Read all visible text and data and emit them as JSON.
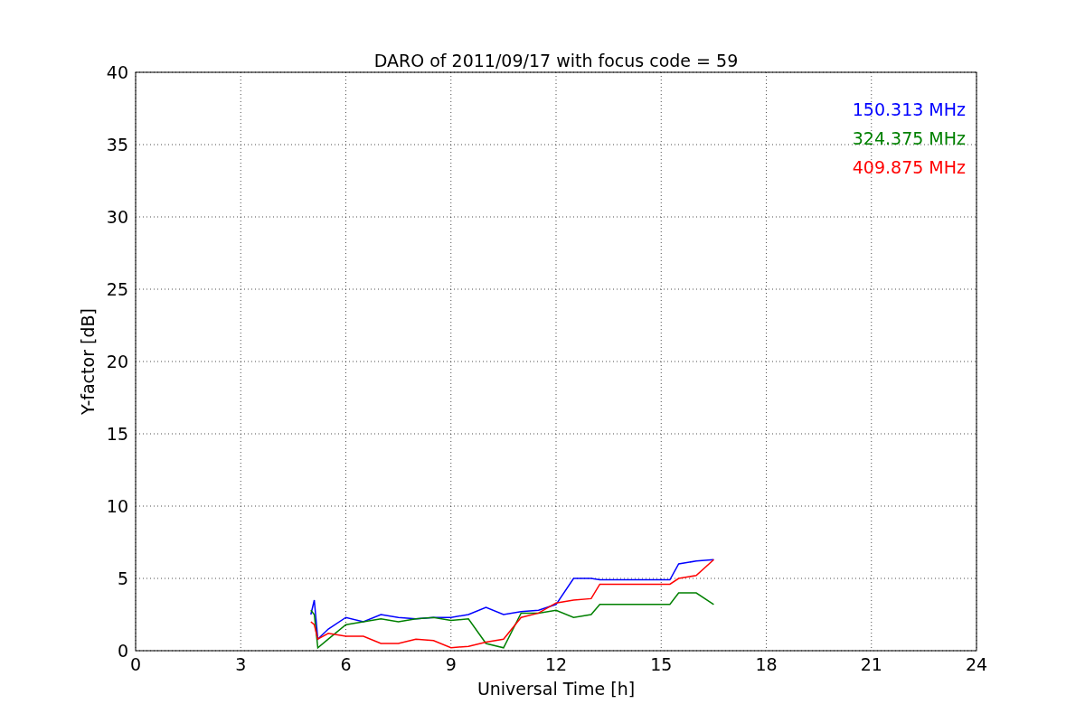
{
  "chart_data": {
    "type": "line",
    "title": "DARO of 2011/09/17 with focus code = 59",
    "xlabel": "Universal Time [h]",
    "ylabel": "Y-factor [dB]",
    "x": [
      5,
      5.1,
      5.2,
      5.5,
      6,
      6.5,
      7,
      7.5,
      8,
      8.5,
      9,
      9.5,
      10,
      10.5,
      11,
      11.5,
      12,
      12.5,
      13,
      13.25,
      15.25,
      15.5,
      16,
      16.5
    ],
    "series": [
      {
        "name": "150.313 MHz",
        "color": "#0000ff",
        "values": [
          2.5,
          3.5,
          0.8,
          1.5,
          2.3,
          2.0,
          2.5,
          2.3,
          2.2,
          2.3,
          2.3,
          2.5,
          3.0,
          2.5,
          2.7,
          2.8,
          3.2,
          5.0,
          5.0,
          4.9,
          4.9,
          6.0,
          6.2,
          6.3
        ]
      },
      {
        "name": "324.375 MHz",
        "color": "#008000",
        "values": [
          2.8,
          2.5,
          0.2,
          0.8,
          1.8,
          2.0,
          2.2,
          2.0,
          2.2,
          2.3,
          2.1,
          2.2,
          0.5,
          0.2,
          2.6,
          2.6,
          2.8,
          2.3,
          2.5,
          3.2,
          3.2,
          4.0,
          4.0,
          3.2
        ]
      },
      {
        "name": "409.875 MHz",
        "color": "#ff0000",
        "values": [
          2.0,
          1.8,
          0.8,
          1.2,
          1.0,
          1.0,
          0.5,
          0.5,
          0.8,
          0.7,
          0.2,
          0.3,
          0.6,
          0.8,
          2.3,
          2.6,
          3.3,
          3.5,
          3.6,
          4.6,
          4.6,
          5.0,
          5.2,
          6.3
        ]
      }
    ],
    "xlim": [
      0,
      24
    ],
    "ylim": [
      0,
      40
    ],
    "xticks": [
      0,
      3,
      6,
      9,
      12,
      15,
      18,
      21,
      24
    ],
    "yticks": [
      0,
      5,
      10,
      15,
      20,
      25,
      30,
      35,
      40
    ],
    "grid": true
  }
}
